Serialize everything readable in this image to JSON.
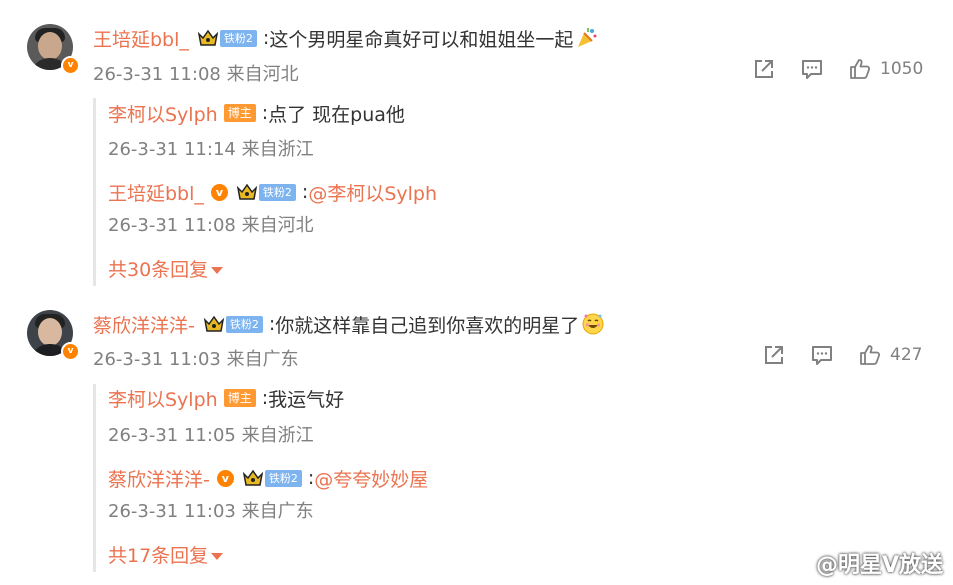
{
  "comments": [
    {
      "username": "王培延bbl_",
      "fan_badge": "铁粉2",
      "separator": ":",
      "text": "这个男明星命真好可以和姐姐坐一起",
      "time": "26-3-31 11:08 来自河北",
      "likes": "1050",
      "replies": [
        {
          "username": "李柯以Sylph",
          "badge": "博主",
          "separator": ":",
          "text": "点了 现在pua他",
          "time": "26-3-31 11:14 来自浙江"
        },
        {
          "username": "王培延bbl_",
          "fan_badge": "铁粉2",
          "separator": ":",
          "mention": "@李柯以Sylph",
          "time": "26-3-31 11:08 来自河北"
        }
      ],
      "more_replies": "共30条回复"
    },
    {
      "username": "蔡欣洋洋洋-",
      "fan_badge": "铁粉2",
      "separator": ":",
      "text": "你就这样靠自己追到你喜欢的明星了",
      "time": "26-3-31 11:03 来自广东",
      "likes": "427",
      "replies": [
        {
          "username": "李柯以Sylph",
          "badge": "博主",
          "separator": ":",
          "text": "我运气好",
          "time": "26-3-31 11:05 来自浙江"
        },
        {
          "username": "蔡欣洋洋洋-",
          "fan_badge": "铁粉2",
          "separator": ":",
          "mention": "@夸夸妙妙屋",
          "time": "26-3-31 11:03 来自广东"
        }
      ],
      "more_replies": "共17条回复"
    }
  ],
  "v_badge_letter": "v",
  "watermark": "@明星V放送",
  "colors": {
    "accent": "#eb7350",
    "meta": "#808080",
    "fan_badge": "#7db4ef",
    "host_badge": "#ff9a33",
    "verified": "#ff8200"
  },
  "icons": [
    "share-icon",
    "comment-icon",
    "like-icon",
    "crown-icon",
    "weibo-logo-icon"
  ]
}
